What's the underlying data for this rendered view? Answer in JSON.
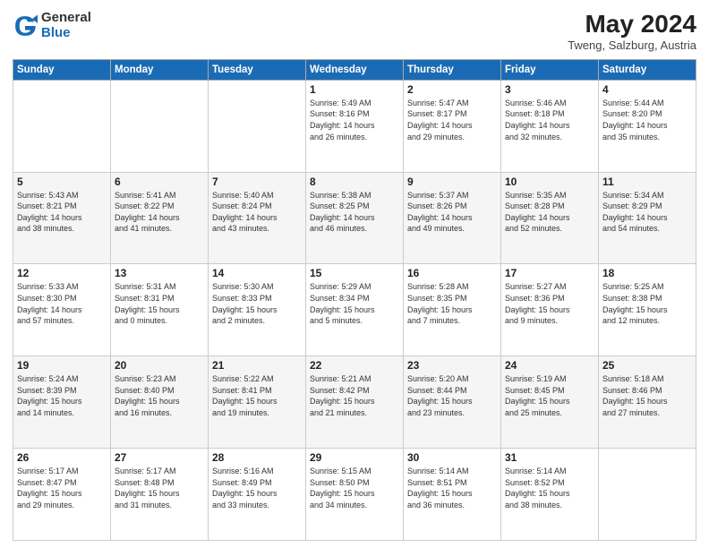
{
  "header": {
    "logo": {
      "general": "General",
      "blue": "Blue"
    },
    "month_year": "May 2024",
    "location": "Tweng, Salzburg, Austria"
  },
  "weekdays": [
    "Sunday",
    "Monday",
    "Tuesday",
    "Wednesday",
    "Thursday",
    "Friday",
    "Saturday"
  ],
  "weeks": [
    [
      {
        "day": "",
        "text": ""
      },
      {
        "day": "",
        "text": ""
      },
      {
        "day": "",
        "text": ""
      },
      {
        "day": "1",
        "text": "Sunrise: 5:49 AM\nSunset: 8:16 PM\nDaylight: 14 hours\nand 26 minutes."
      },
      {
        "day": "2",
        "text": "Sunrise: 5:47 AM\nSunset: 8:17 PM\nDaylight: 14 hours\nand 29 minutes."
      },
      {
        "day": "3",
        "text": "Sunrise: 5:46 AM\nSunset: 8:18 PM\nDaylight: 14 hours\nand 32 minutes."
      },
      {
        "day": "4",
        "text": "Sunrise: 5:44 AM\nSunset: 8:20 PM\nDaylight: 14 hours\nand 35 minutes."
      }
    ],
    [
      {
        "day": "5",
        "text": "Sunrise: 5:43 AM\nSunset: 8:21 PM\nDaylight: 14 hours\nand 38 minutes."
      },
      {
        "day": "6",
        "text": "Sunrise: 5:41 AM\nSunset: 8:22 PM\nDaylight: 14 hours\nand 41 minutes."
      },
      {
        "day": "7",
        "text": "Sunrise: 5:40 AM\nSunset: 8:24 PM\nDaylight: 14 hours\nand 43 minutes."
      },
      {
        "day": "8",
        "text": "Sunrise: 5:38 AM\nSunset: 8:25 PM\nDaylight: 14 hours\nand 46 minutes."
      },
      {
        "day": "9",
        "text": "Sunrise: 5:37 AM\nSunset: 8:26 PM\nDaylight: 14 hours\nand 49 minutes."
      },
      {
        "day": "10",
        "text": "Sunrise: 5:35 AM\nSunset: 8:28 PM\nDaylight: 14 hours\nand 52 minutes."
      },
      {
        "day": "11",
        "text": "Sunrise: 5:34 AM\nSunset: 8:29 PM\nDaylight: 14 hours\nand 54 minutes."
      }
    ],
    [
      {
        "day": "12",
        "text": "Sunrise: 5:33 AM\nSunset: 8:30 PM\nDaylight: 14 hours\nand 57 minutes."
      },
      {
        "day": "13",
        "text": "Sunrise: 5:31 AM\nSunset: 8:31 PM\nDaylight: 15 hours\nand 0 minutes."
      },
      {
        "day": "14",
        "text": "Sunrise: 5:30 AM\nSunset: 8:33 PM\nDaylight: 15 hours\nand 2 minutes."
      },
      {
        "day": "15",
        "text": "Sunrise: 5:29 AM\nSunset: 8:34 PM\nDaylight: 15 hours\nand 5 minutes."
      },
      {
        "day": "16",
        "text": "Sunrise: 5:28 AM\nSunset: 8:35 PM\nDaylight: 15 hours\nand 7 minutes."
      },
      {
        "day": "17",
        "text": "Sunrise: 5:27 AM\nSunset: 8:36 PM\nDaylight: 15 hours\nand 9 minutes."
      },
      {
        "day": "18",
        "text": "Sunrise: 5:25 AM\nSunset: 8:38 PM\nDaylight: 15 hours\nand 12 minutes."
      }
    ],
    [
      {
        "day": "19",
        "text": "Sunrise: 5:24 AM\nSunset: 8:39 PM\nDaylight: 15 hours\nand 14 minutes."
      },
      {
        "day": "20",
        "text": "Sunrise: 5:23 AM\nSunset: 8:40 PM\nDaylight: 15 hours\nand 16 minutes."
      },
      {
        "day": "21",
        "text": "Sunrise: 5:22 AM\nSunset: 8:41 PM\nDaylight: 15 hours\nand 19 minutes."
      },
      {
        "day": "22",
        "text": "Sunrise: 5:21 AM\nSunset: 8:42 PM\nDaylight: 15 hours\nand 21 minutes."
      },
      {
        "day": "23",
        "text": "Sunrise: 5:20 AM\nSunset: 8:44 PM\nDaylight: 15 hours\nand 23 minutes."
      },
      {
        "day": "24",
        "text": "Sunrise: 5:19 AM\nSunset: 8:45 PM\nDaylight: 15 hours\nand 25 minutes."
      },
      {
        "day": "25",
        "text": "Sunrise: 5:18 AM\nSunset: 8:46 PM\nDaylight: 15 hours\nand 27 minutes."
      }
    ],
    [
      {
        "day": "26",
        "text": "Sunrise: 5:17 AM\nSunset: 8:47 PM\nDaylight: 15 hours\nand 29 minutes."
      },
      {
        "day": "27",
        "text": "Sunrise: 5:17 AM\nSunset: 8:48 PM\nDaylight: 15 hours\nand 31 minutes."
      },
      {
        "day": "28",
        "text": "Sunrise: 5:16 AM\nSunset: 8:49 PM\nDaylight: 15 hours\nand 33 minutes."
      },
      {
        "day": "29",
        "text": "Sunrise: 5:15 AM\nSunset: 8:50 PM\nDaylight: 15 hours\nand 34 minutes."
      },
      {
        "day": "30",
        "text": "Sunrise: 5:14 AM\nSunset: 8:51 PM\nDaylight: 15 hours\nand 36 minutes."
      },
      {
        "day": "31",
        "text": "Sunrise: 5:14 AM\nSunset: 8:52 PM\nDaylight: 15 hours\nand 38 minutes."
      },
      {
        "day": "",
        "text": ""
      }
    ]
  ]
}
